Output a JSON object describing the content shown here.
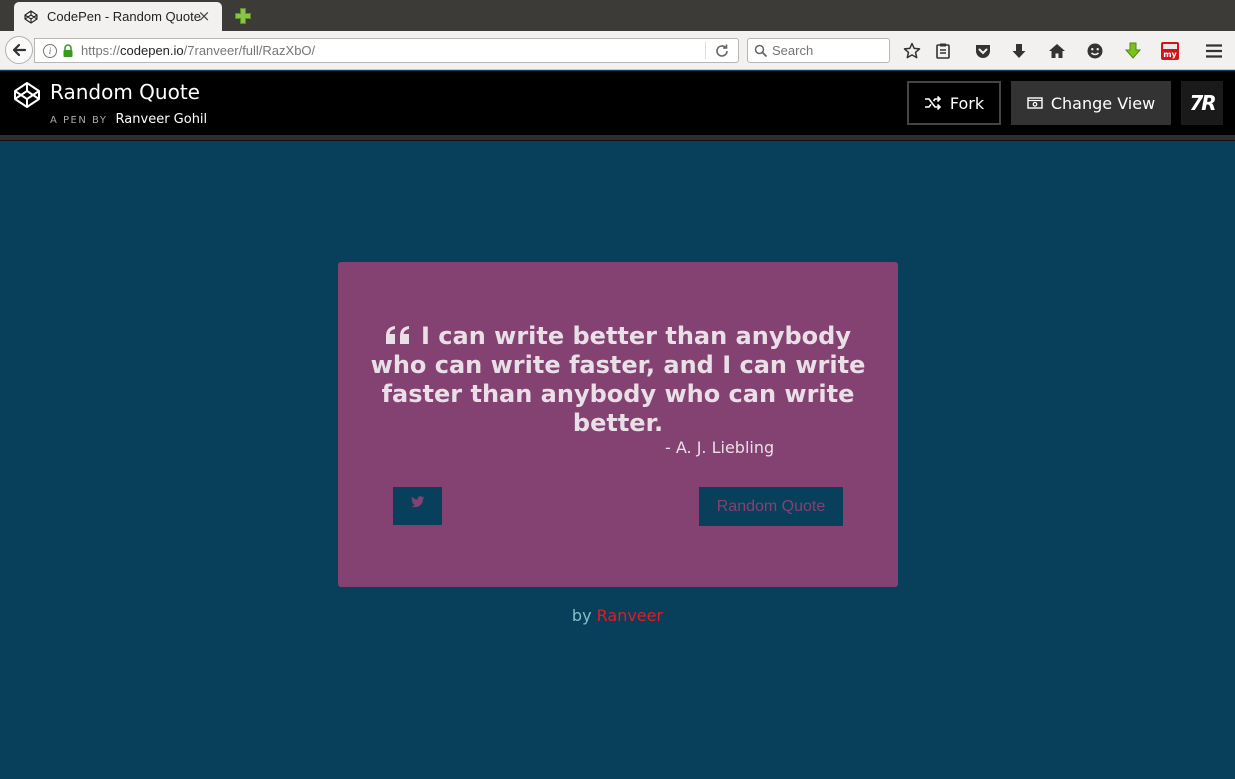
{
  "browser": {
    "tab_title": "CodePen - Random Quote",
    "tab_close": "×",
    "url_prefix": "https://",
    "url_host": "codepen.io",
    "url_path": "/7ranveer/full/RazXbO/",
    "search_placeholder": "Search"
  },
  "header": {
    "title": "Random Quote",
    "pen_by": "A PEN BY",
    "author": "Ranveer Gohil",
    "fork_label": "Fork",
    "change_view_label": "Change View",
    "avatar_text": "7R"
  },
  "quote": {
    "text": "I can write better than anybody who can write faster, and I can write faster than anybody who can write better.",
    "author": "- A. J. Liebling",
    "random_button": "Random Quote"
  },
  "footer": {
    "by": "by",
    "name": "Ranveer"
  },
  "colors": {
    "background": "#083f5b",
    "card": "#834272",
    "credit_name": "#e31b23"
  }
}
